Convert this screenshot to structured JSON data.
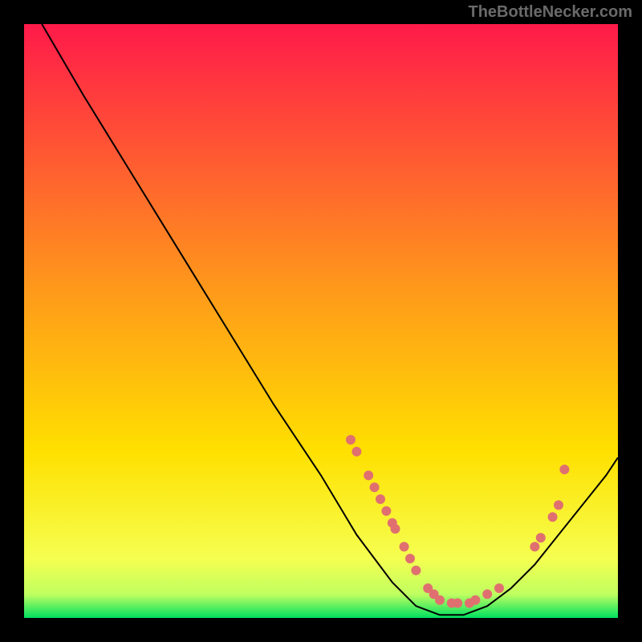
{
  "watermark": "TheBottleNecker.com",
  "chart_data": {
    "type": "line",
    "title": "",
    "xlabel": "",
    "ylabel": "",
    "xlim": [
      0,
      100
    ],
    "ylim": [
      0,
      100
    ],
    "background_gradient": {
      "top": "#ff1a4a",
      "mid": "#ffe000",
      "bottom": "#00e060"
    },
    "curve": [
      {
        "x": 3,
        "y": 100
      },
      {
        "x": 10,
        "y": 88
      },
      {
        "x": 18,
        "y": 75
      },
      {
        "x": 26,
        "y": 62
      },
      {
        "x": 34,
        "y": 49
      },
      {
        "x": 42,
        "y": 36
      },
      {
        "x": 50,
        "y": 24
      },
      {
        "x": 56,
        "y": 14
      },
      {
        "x": 62,
        "y": 6
      },
      {
        "x": 66,
        "y": 2
      },
      {
        "x": 70,
        "y": 0.5
      },
      {
        "x": 74,
        "y": 0.5
      },
      {
        "x": 78,
        "y": 2
      },
      {
        "x": 82,
        "y": 5
      },
      {
        "x": 86,
        "y": 9
      },
      {
        "x": 90,
        "y": 14
      },
      {
        "x": 94,
        "y": 19
      },
      {
        "x": 98,
        "y": 24
      },
      {
        "x": 100,
        "y": 27
      }
    ],
    "markers": [
      {
        "x": 55,
        "y": 30
      },
      {
        "x": 56,
        "y": 28
      },
      {
        "x": 58,
        "y": 24
      },
      {
        "x": 59,
        "y": 22
      },
      {
        "x": 60,
        "y": 20
      },
      {
        "x": 61,
        "y": 18
      },
      {
        "x": 62,
        "y": 16
      },
      {
        "x": 62.5,
        "y": 15
      },
      {
        "x": 64,
        "y": 12
      },
      {
        "x": 65,
        "y": 10
      },
      {
        "x": 66,
        "y": 8
      },
      {
        "x": 68,
        "y": 5
      },
      {
        "x": 69,
        "y": 4
      },
      {
        "x": 70,
        "y": 3
      },
      {
        "x": 72,
        "y": 2.5
      },
      {
        "x": 73,
        "y": 2.5
      },
      {
        "x": 75,
        "y": 2.5
      },
      {
        "x": 76,
        "y": 3
      },
      {
        "x": 78,
        "y": 4
      },
      {
        "x": 80,
        "y": 5
      },
      {
        "x": 86,
        "y": 12
      },
      {
        "x": 87,
        "y": 13.5
      },
      {
        "x": 89,
        "y": 17
      },
      {
        "x": 90,
        "y": 19
      },
      {
        "x": 91,
        "y": 25
      }
    ],
    "marker_color": "#e07070"
  }
}
